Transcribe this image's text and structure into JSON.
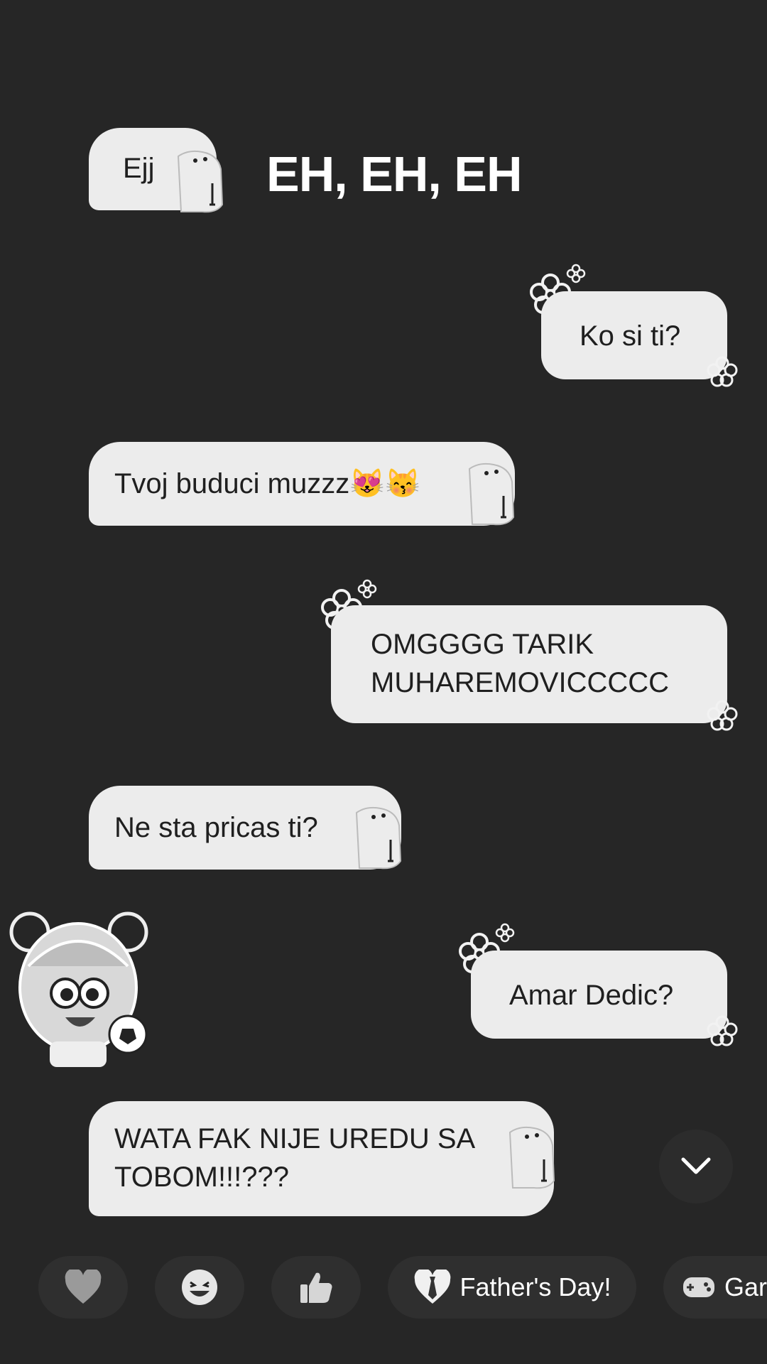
{
  "heading": "EH, EH, EH",
  "messages": [
    {
      "side": "in",
      "text": "Ejj"
    },
    {
      "side": "out",
      "text": "Ko si ti?"
    },
    {
      "side": "in",
      "text": "Tvoj buduci muzzz😻😽"
    },
    {
      "side": "out",
      "text": "OMGGGG TARIK\nMUHAREMOVICCCCC"
    },
    {
      "side": "in",
      "text": "Ne sta pricas ti?"
    },
    {
      "side": "out",
      "text": "Amar Dedic?"
    },
    {
      "side": "in",
      "text": "WATA FAK NIJE UREDU SA\nTOBOM!!!???"
    }
  ],
  "reactions": [
    {
      "icon": "heart-icon",
      "label": ""
    },
    {
      "icon": "laughing-face-icon",
      "label": ""
    },
    {
      "icon": "thumbs-up-icon",
      "label": ""
    },
    {
      "icon": "broken-heart-tie-icon",
      "label": "Father's Day!"
    },
    {
      "icon": "game-controller-icon",
      "label": "Gar"
    }
  ],
  "scroll_down_icon": "chevron-down-icon",
  "colors": {
    "background": "#262626",
    "bubble": "#ececec",
    "chip": "#2f2f2f"
  }
}
